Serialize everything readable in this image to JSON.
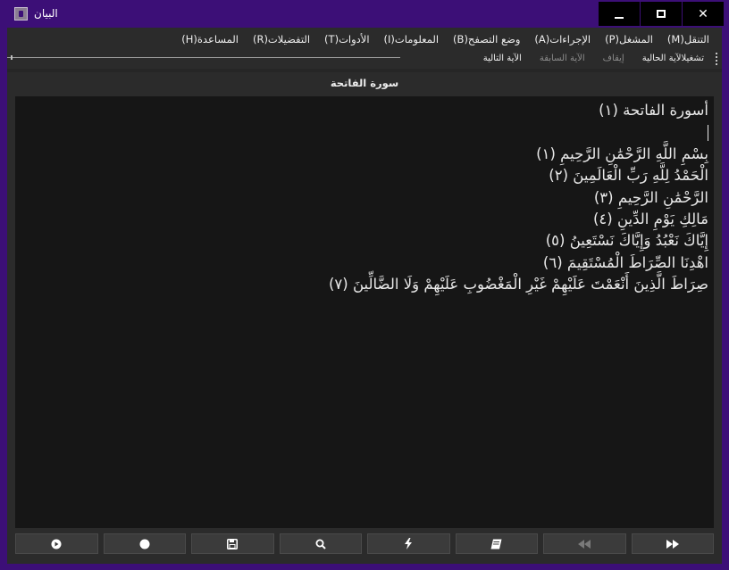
{
  "window": {
    "title": "البيان",
    "controls": {
      "minimize": "minimize-icon",
      "maximize": "maximize-icon",
      "close": "✕"
    }
  },
  "menu": {
    "items": [
      {
        "label": "التنقل(M)"
      },
      {
        "label": "المشغل(P)"
      },
      {
        "label": "الإجراءات(A)"
      },
      {
        "label": "وضع التصفح(B)"
      },
      {
        "label": "المعلومات(I)"
      },
      {
        "label": "الأدوات(T)"
      },
      {
        "label": "التفضيلات(R)"
      },
      {
        "label": "المساعدة(H)"
      }
    ]
  },
  "toolbar": {
    "items": [
      {
        "label": "تشغيلالآية الحالية",
        "enabled": true
      },
      {
        "label": "إيقاف",
        "enabled": false
      },
      {
        "label": "الآية السابقة",
        "enabled": false
      },
      {
        "label": "الآية التالية",
        "enabled": true
      }
    ]
  },
  "surah": {
    "heading": "سورة الفاتحة",
    "lines": [
      "أسورة الفاتحة (١)",
      "",
      "بِسْمِ اللَّهِ الرَّحْمَٰنِ الرَّحِيمِ (١)",
      "الْحَمْدُ لِلَّهِ رَبِّ الْعَالَمِينَ (٢)",
      "الرَّحْمَٰنِ الرَّحِيمِ (٣)",
      "مَالِكِ يَوْمِ الدِّينِ (٤)",
      "إِيَّاكَ نَعْبُدُ وَإِيَّاكَ نَسْتَعِينُ (٥)",
      "اهْدِنَا الصِّرَاطَ الْمُسْتَقِيمَ (٦)",
      "صِرَاطَ الَّذِينَ أَنْعَمْتَ عَلَيْهِمْ غَيْرِ الْمَغْضُوبِ عَلَيْهِمْ وَلَا الضَّالِّينَ (٧)"
    ]
  },
  "bottom_buttons": [
    {
      "icon": "play-circle-icon",
      "enabled": true
    },
    {
      "icon": "record-icon",
      "enabled": true
    },
    {
      "icon": "save-icon",
      "enabled": true
    },
    {
      "icon": "search-icon",
      "enabled": true
    },
    {
      "icon": "lightning-icon",
      "enabled": true
    },
    {
      "icon": "book-icon",
      "enabled": true
    },
    {
      "icon": "rewind-icon",
      "enabled": false
    },
    {
      "icon": "fast-forward-icon",
      "enabled": true
    }
  ],
  "colors": {
    "window_frame": "#3c0f77",
    "client_bg": "#2b2b2b",
    "text_area_bg": "#161616",
    "button_bg": "#3b3b3b"
  }
}
